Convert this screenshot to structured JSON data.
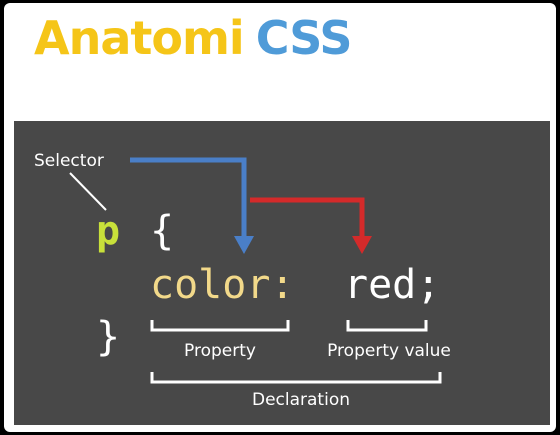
{
  "title": {
    "part1": "Anatomi",
    "part2": "CSS"
  },
  "labels": {
    "selector": "Selector",
    "property": "Property",
    "property_value": "Property value",
    "declaration": "Declaration"
  },
  "code": {
    "selector": "p",
    "open_brace": "{",
    "property": "color:",
    "value": "red;",
    "close_brace": "}"
  },
  "colors": {
    "title_accent": "#f5c518",
    "title_css": "#4f9bd8",
    "selector_code": "#c8e03a",
    "property_code": "#f2d98a",
    "arrow_blue": "#4a7fc8",
    "arrow_red": "#d42a2a",
    "panel_bg": "#484848"
  }
}
